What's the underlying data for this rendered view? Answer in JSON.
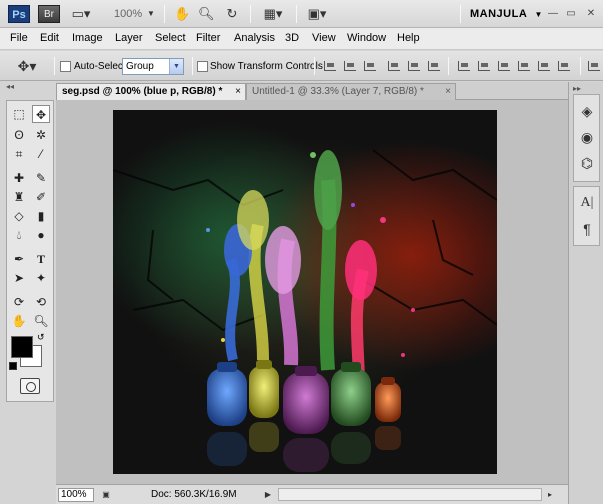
{
  "appbar": {
    "ps_logo": "Ps",
    "br_logo": "Br",
    "zoom": "100%",
    "workspace": "MANJULA",
    "workspace_arrow": "▼",
    "icons": [
      "launch-bridge-icon",
      "view-extras-icon",
      "hand-tool-icon",
      "zoom-tool-icon",
      "rotate-view-icon",
      "arrange-documents-icon",
      "screen-mode-icon"
    ]
  },
  "menubar": {
    "items": [
      "File",
      "Edit",
      "Image",
      "Layer",
      "Select",
      "Filter",
      "Analysis",
      "3D",
      "View",
      "Window",
      "Help"
    ]
  },
  "options": {
    "auto_select_label": "Auto-Select:",
    "auto_select_value": "Group",
    "show_transform_label": "Show Transform Controls"
  },
  "tabs": [
    {
      "label": "seg.psd @ 100% (blue p, RGB/8) *",
      "close": "×",
      "active": true
    },
    {
      "label": "Untitled-1 @ 33.3% (Layer 7, RGB/8) *",
      "close": "×",
      "active": false
    }
  ],
  "status": {
    "zoom": "100%",
    "doc": "Doc: 560.3K/16.9M",
    "arrow": "▶"
  },
  "colors": {
    "foreground": "#000000",
    "background": "#ffffff",
    "vase_blue": "#2b5fae",
    "vase_yellow": "#c9c430",
    "vase_purple": "#8a3a8c",
    "vase_green": "#3f7a3a",
    "vase_orange": "#c0571f"
  }
}
